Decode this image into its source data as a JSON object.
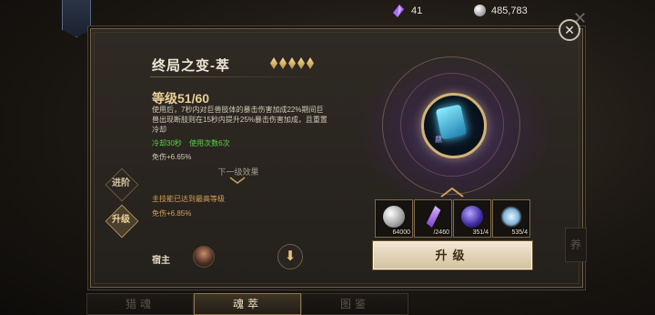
{
  "currency": {
    "gem": {
      "icon": "purple-crystal-icon",
      "value": "41"
    },
    "coin": {
      "icon": "silver-coin-icon",
      "value": "485,783"
    }
  },
  "skill": {
    "title": "终局之变-萃",
    "star_count": 5,
    "level": "等级51/60",
    "description": "使用后，7秒内对巨兽肢体的暴击伤害加成22%期间巨兽出现断肢则在15秒内提升25%暴击伤害加成，且重置冷却",
    "cooldown": "冷却30秒",
    "uses": "使用次数6次",
    "stat_current": "免伤+6.65%",
    "next_label": "下一级效果",
    "maxed_note": "主技能已达到最高等级",
    "stat_next": "免伤+6.85%"
  },
  "side_tabs": {
    "advance": "进阶",
    "upgrade": "升级"
  },
  "host": {
    "label": "宿主"
  },
  "materials": [
    {
      "name": "silver-coin",
      "count": "64000"
    },
    {
      "name": "purple-crystal",
      "count": "/2460"
    },
    {
      "name": "soul-orb",
      "count": "351/4"
    },
    {
      "name": "frost-essence",
      "count": "535/4"
    }
  ],
  "upgrade_button": "升级",
  "rune_badge": "鼎",
  "bottom_tabs": [
    "猎魂",
    "魂萃",
    "图鉴"
  ],
  "right_tab": "养",
  "colors": {
    "accent": "#e9cf96",
    "green": "#5bd24c",
    "orange": "#d9a05a"
  }
}
